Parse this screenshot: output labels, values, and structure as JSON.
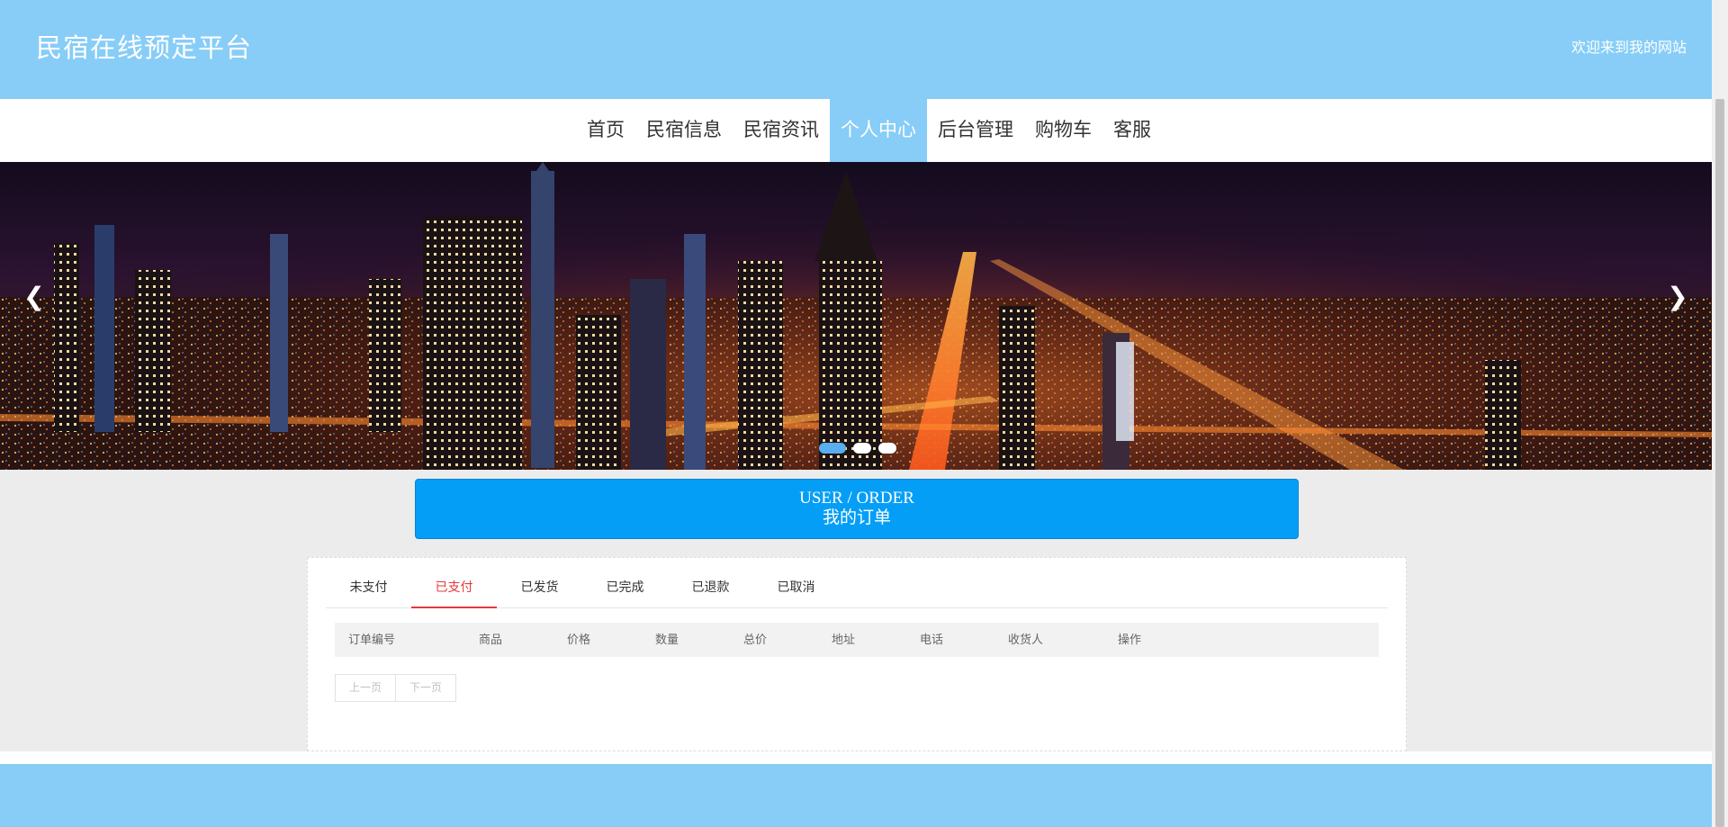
{
  "header": {
    "site_title": "民宿在线预定平台",
    "welcome": "欢迎来到我的网站"
  },
  "nav": {
    "items": [
      {
        "label": "首页"
      },
      {
        "label": "民宿信息"
      },
      {
        "label": "民宿资讯"
      },
      {
        "label": "个人中心"
      },
      {
        "label": "后台管理"
      },
      {
        "label": "购物车"
      },
      {
        "label": "客服"
      }
    ],
    "active": "个人中心"
  },
  "banner": {
    "prev_icon": "chevron-left-icon",
    "next_icon": "chevron-right-icon",
    "slide_count": 3,
    "active_slide": 1
  },
  "order_heading": {
    "en": "USER / ORDER",
    "cn": "我的订单"
  },
  "tabs": {
    "items": [
      {
        "label": "未支付"
      },
      {
        "label": "已支付"
      },
      {
        "label": "已发货"
      },
      {
        "label": "已完成"
      },
      {
        "label": "已退款"
      },
      {
        "label": "已取消"
      }
    ],
    "active": "已支付"
  },
  "table": {
    "columns": [
      "订单编号",
      "商品",
      "价格",
      "数量",
      "总价",
      "地址",
      "电话",
      "收货人",
      "操作"
    ],
    "rows": []
  },
  "pager": {
    "prev": "上一页",
    "next": "下一页"
  },
  "colors": {
    "header_bg": "#87cdf7",
    "heading_blue": "#059ef7",
    "tab_active": "#e4393c"
  }
}
